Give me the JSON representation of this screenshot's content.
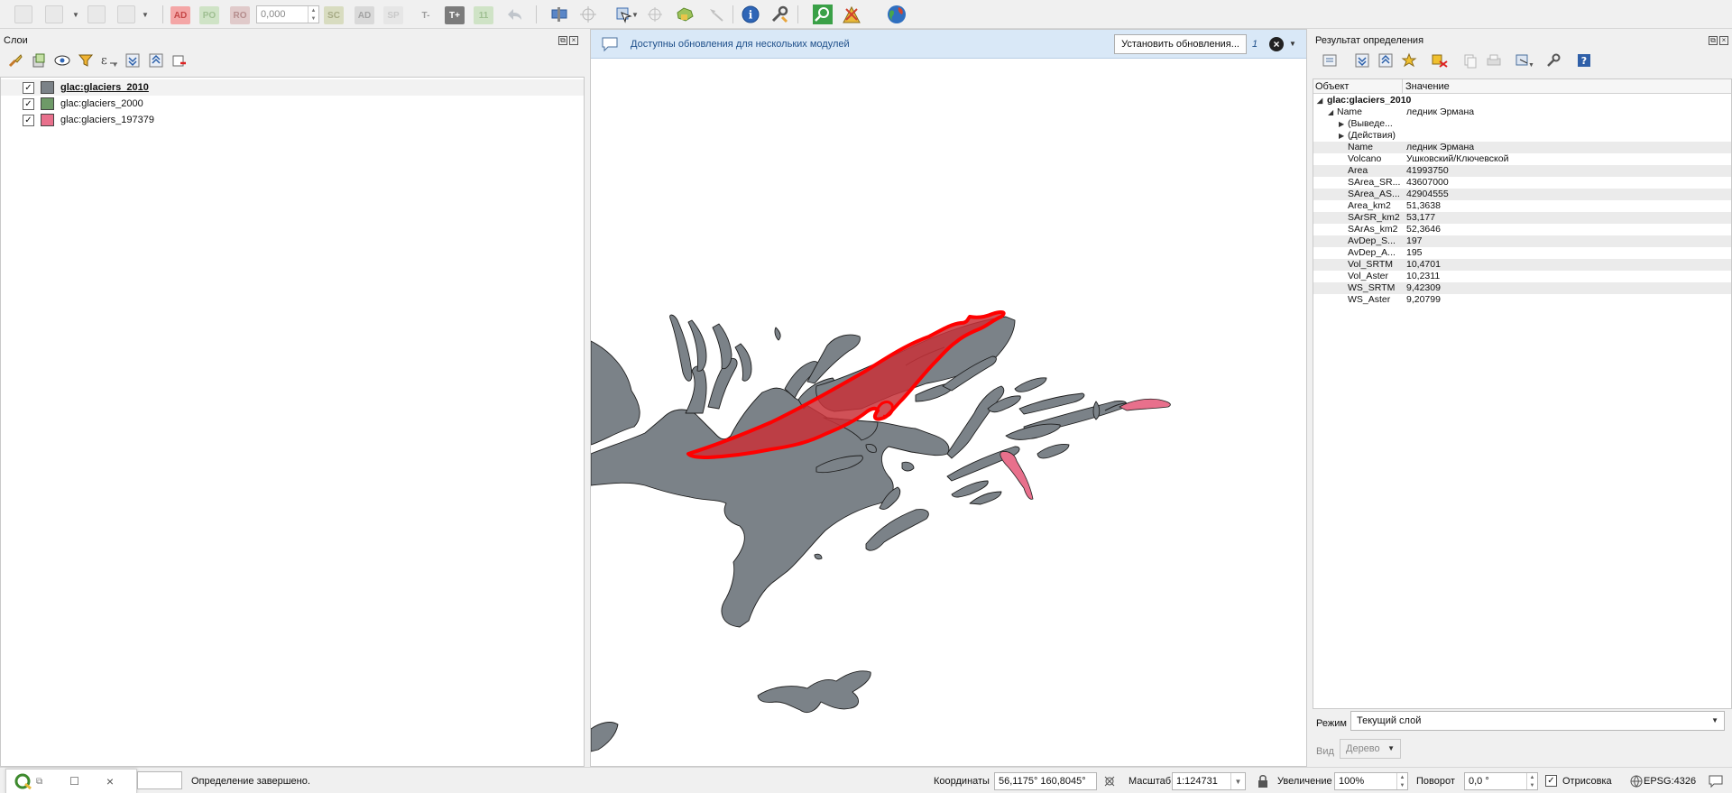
{
  "toolbar": {
    "digitize_badges": [
      "AD",
      "PO",
      "RO",
      "SC",
      "AD",
      "SP",
      "T-",
      "T+",
      "11"
    ],
    "snap_tolerance": "0,000"
  },
  "layers_panel": {
    "title": "Слои",
    "layers": [
      {
        "name": "glac:glaciers_2010",
        "checked": true,
        "color": "#7b8288",
        "active": true
      },
      {
        "name": "glac:glaciers_2000",
        "checked": true,
        "color": "#6e9a68",
        "active": false
      },
      {
        "name": "glac:glaciers_197379",
        "checked": true,
        "color": "#e8708c",
        "active": false
      }
    ]
  },
  "map": {
    "message": "Доступны обновления для нескольких модулей",
    "message_button": "Установить обновления...",
    "message_count": "1",
    "colors": {
      "glacier_2010": "#7b8288",
      "glacier_197379": "#e8708c",
      "selection": "#ff0000"
    }
  },
  "identify": {
    "title": "Результат определения",
    "col_feature": "Объект",
    "col_value": "Значение",
    "layer": "glac:glaciers_2010",
    "feature_key": "Name",
    "feature_value": "ледник Эрмана",
    "derived": "(Выведе...",
    "actions": "(Действия)",
    "attributes": [
      {
        "key": "Name",
        "value": "ледник Эрмана"
      },
      {
        "key": "Volcano",
        "value": "Ушковский/Ключевской"
      },
      {
        "key": "Area",
        "value": "41993750"
      },
      {
        "key": "SArea_SR...",
        "value": "43607000"
      },
      {
        "key": "SArea_AS...",
        "value": "42904555"
      },
      {
        "key": "Area_km2",
        "value": "51,3638"
      },
      {
        "key": "SArSR_km2",
        "value": "53,177"
      },
      {
        "key": "SArAs_km2",
        "value": "52,3646"
      },
      {
        "key": "AvDep_S...",
        "value": "197"
      },
      {
        "key": "AvDep_A...",
        "value": "195"
      },
      {
        "key": "Vol_SRTM",
        "value": "10,4701"
      },
      {
        "key": "Vol_Aster",
        "value": "10,2311"
      },
      {
        "key": "WS_SRTM",
        "value": "9,42309"
      },
      {
        "key": "WS_Aster",
        "value": "9,20799"
      }
    ],
    "mode_label": "Режим",
    "mode_value": "Текущий слой",
    "view_label": "Вид",
    "view_value": "Дерево"
  },
  "statusbar": {
    "status_text": "Определение завершено.",
    "coord_label": "Координаты",
    "coord_value": "56,1175° 160,8045°",
    "scale_label": "Масштаб",
    "scale_value": "1:124731",
    "magnifier_label": "Увеличение",
    "magnifier_value": "100%",
    "rotation_label": "Поворот",
    "rotation_value": "0,0 °",
    "render_label": "Отрисовка",
    "crs": "EPSG:4326"
  }
}
